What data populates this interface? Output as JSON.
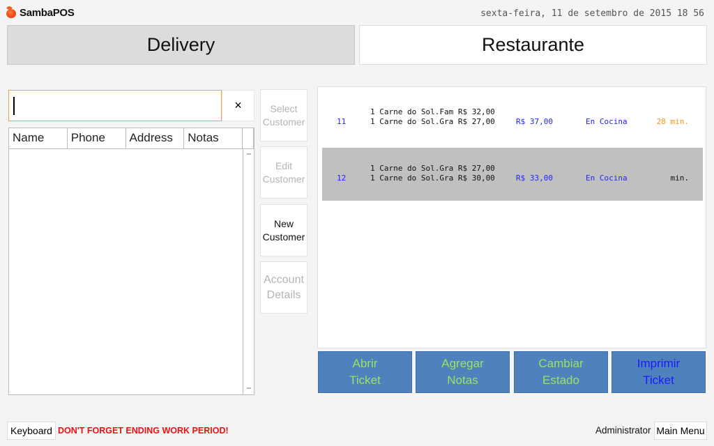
{
  "app": {
    "title": "SambaPOS",
    "logo_icon": "apple-logo-icon",
    "datetime": "sexta-feira, 11 de setembro de 2015 18 56"
  },
  "departments": [
    {
      "label": "Delivery",
      "selected": true
    },
    {
      "label": "Restaurante",
      "selected": false
    }
  ],
  "search": {
    "value": "",
    "placeholder": "",
    "clear_label": "×",
    "clear_icon": "close-icon"
  },
  "customer_grid": {
    "columns": [
      "Name",
      "Phone",
      "Address",
      "Notas"
    ],
    "rows": []
  },
  "customer_actions": [
    {
      "label": "Select Customer",
      "enabled": false
    },
    {
      "label": "Edit Customer",
      "enabled": false
    },
    {
      "label": "New Customer",
      "enabled": true
    },
    {
      "label": "Account Details",
      "enabled": false
    }
  ],
  "tickets": [
    {
      "number": "11",
      "lines": [
        "1 Carne do Sol.Fam R$ 32,00",
        "1 Carne do Sol.Gra R$ 27,00"
      ],
      "total": "R$ 37,00",
      "state": "En Cocina",
      "time": "28 min.",
      "time_color": "#f7941d",
      "selected": false
    },
    {
      "number": "12",
      "lines": [
        "1 Carne do Sol.Gra R$ 27,00",
        "1 Carne do Sol.Gra R$ 30,00"
      ],
      "total": "R$ 33,00",
      "state": "En Cocina",
      "time": "min.",
      "time_color": "#111111",
      "selected": true
    }
  ],
  "ticket_actions": [
    {
      "line1": "Abrir",
      "line2": "Ticket",
      "color": "#9be35f"
    },
    {
      "line1": "Agregar",
      "line2": "Notas",
      "color": "#9be35f"
    },
    {
      "line1": "Cambiar",
      "line2": "Estado",
      "color": "#9be35f"
    },
    {
      "line1": "Imprimir",
      "line2": "Ticket",
      "color": "#1a1aff"
    }
  ],
  "footer": {
    "keyboard_label": "Keyboard",
    "warning": "DON'T FORGET ENDING WORK PERIOD!",
    "user": "Administrator",
    "main_menu_label": "Main Menu"
  },
  "colors": {
    "accent_blue": "#4f81bd",
    "warning_red": "#ee1111",
    "search_focus": "#f0a040",
    "selected_row": "#c0c0c0"
  }
}
